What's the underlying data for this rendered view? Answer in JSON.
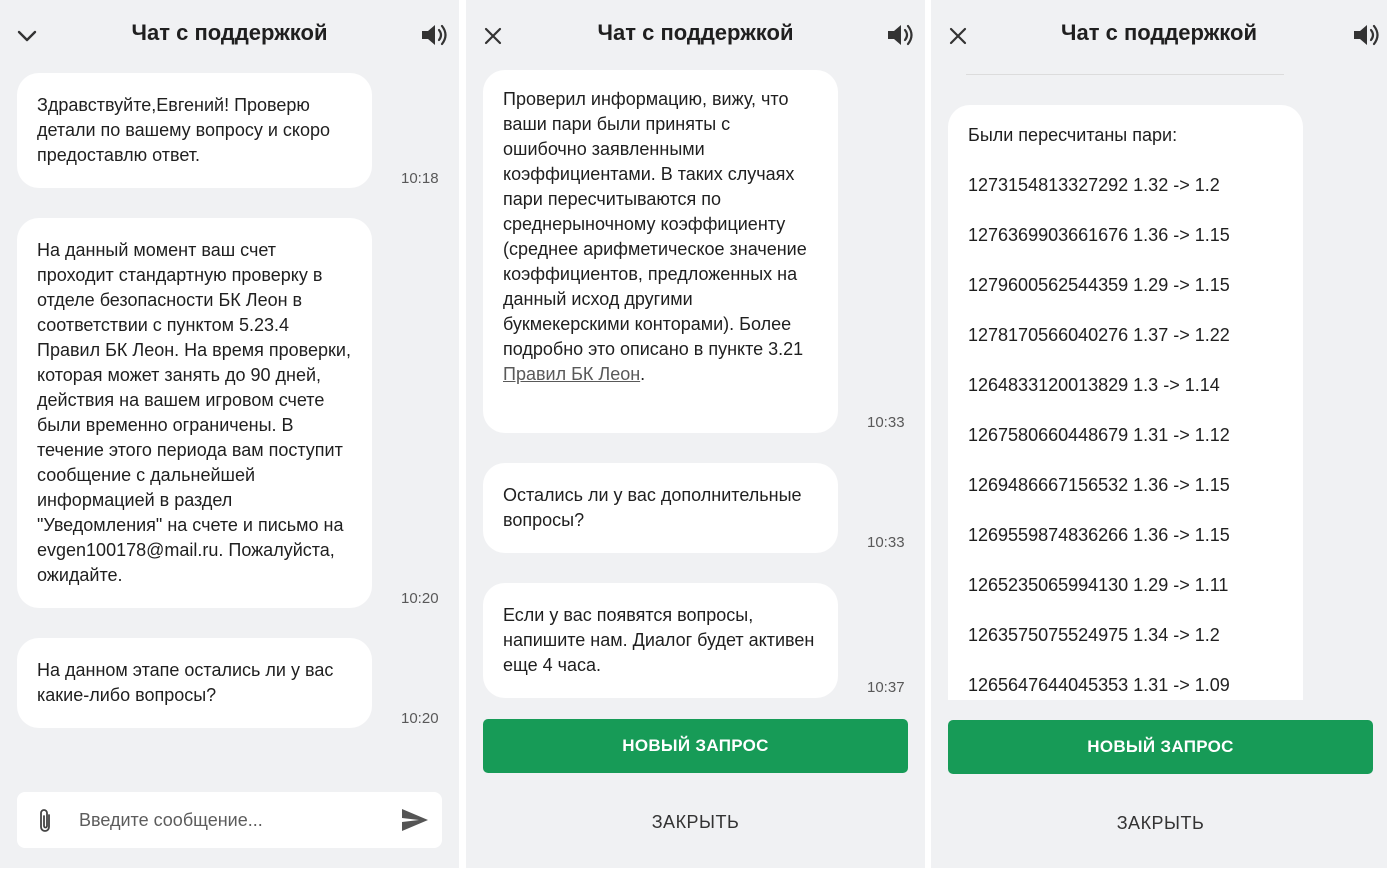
{
  "panel1": {
    "title": "Чат с поддержкой",
    "messages": [
      {
        "text": "Здравствуйте,Евгений! Проверю детали по вашему вопросу и скоро предоставлю ответ.",
        "time": "10:18"
      },
      {
        "text": "На данный момент ваш счет проходит стандартную проверку в отделе безопасности БК Леон в соответствии с пунктом 5.23.4 Правил БК Леон. На время проверки, которая может занять до 90 дней, действия на вашем игровом счете были временно ограничены. В течение этого периода вам поступит сообщение с дальнейшей информацией в раздел \"Уведомления\" на счете и письмо на evgen100178@mail.ru. Пожалуйста, ожидайте.",
        "time": "10:20"
      },
      {
        "text": "На данном этапе остались ли у вас какие-либо вопросы?",
        "time": "10:20"
      }
    ],
    "input_placeholder": "Введите сообщение..."
  },
  "panel2": {
    "title": "Чат с поддержкой",
    "messages": [
      {
        "text": "Проверил информацию, вижу, что ваши пари были приняты с ошибочно заявленными коэффициентами. В таких случаях пари пересчитываются по среднерыночному коэффициенту (среднее арифметическое значение коэффициентов, предложенных на данный исход другими букмекерскими конторами). Более подробно это описано в пункте 3.21 ",
        "link_text": "Правил БК Леон",
        "suffix": ".",
        "time": "10:33"
      },
      {
        "text": "Остались ли у вас дополнительные вопросы?",
        "time": "10:33"
      },
      {
        "text": "Если у вас появятся вопросы, напишите нам. Диалог будет активен еще 4 часа.",
        "time": "10:37"
      }
    ],
    "new_request": "НОВЫЙ ЗАПРОС",
    "close": "ЗАКРЫТЬ"
  },
  "panel3": {
    "title": "Чат с поддержкой",
    "intro": "Были пересчитаны пари:",
    "pairs": [
      "1273154813327292 1.32 -> 1.2",
      "1276369903661676 1.36 -> 1.15",
      "1279600562544359 1.29 -> 1.15",
      "1278170566040276 1.37 -> 1.22",
      "1264833120013829 1.3 -> 1.14",
      "1267580660448679 1.31 -> 1.12",
      "1269486667156532 1.36 -> 1.15",
      "1269559874836266 1.36 -> 1.15",
      "1265235065994130 1.29 -> 1.11",
      "1263575075524975 1.34 -> 1.2",
      "1265647644045353 1.31 -> 1.09"
    ],
    "new_request": "НОВЫЙ ЗАПРОС",
    "close": "ЗАКРЫТЬ"
  },
  "icons": {
    "collapse": "chevron-down-icon",
    "close": "close-icon",
    "sound": "speaker-icon",
    "attach": "paperclip-icon",
    "send": "send-icon"
  },
  "colors": {
    "background": "#f0f1f3",
    "bubble": "#ffffff",
    "primary_button": "#179b57"
  }
}
